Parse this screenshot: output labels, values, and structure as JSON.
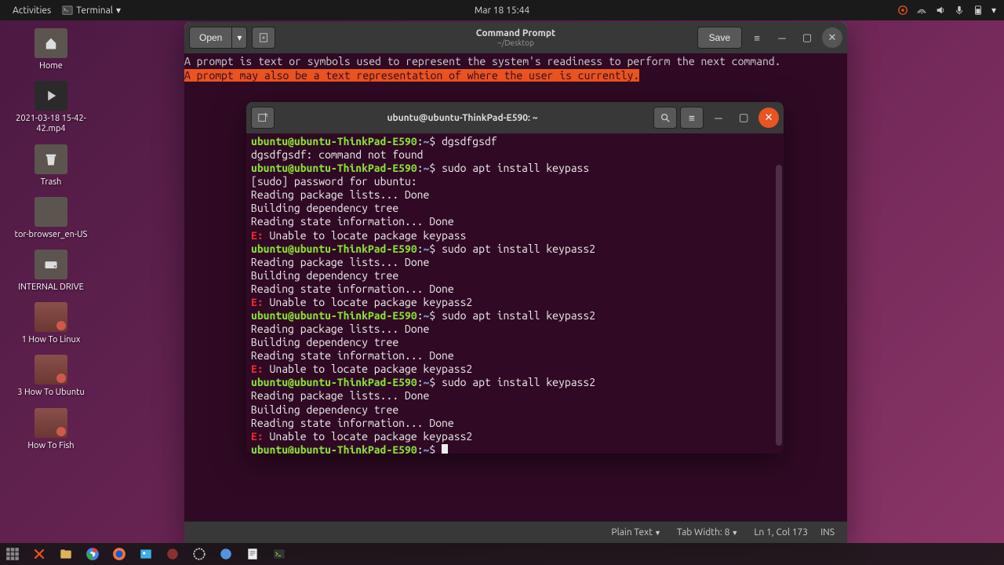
{
  "top_panel": {
    "activities": "Activities",
    "app_menu": "Terminal",
    "clock": "Mar 18  15:44"
  },
  "desktop_icons": [
    {
      "label": "Home",
      "kind": "folder"
    },
    {
      "label": "2021-03-18 15-42-42.mp4",
      "kind": "video"
    },
    {
      "label": "Trash",
      "kind": "folder"
    },
    {
      "label": "tor-browser_en-US",
      "kind": "folder"
    },
    {
      "label": "INTERNAL DRIVE",
      "kind": "folder"
    },
    {
      "label": "1 How To Linux",
      "kind": "folder-red"
    },
    {
      "label": "3 How To Ubuntu",
      "kind": "folder-red"
    },
    {
      "label": "How To Fish",
      "kind": "folder-red"
    }
  ],
  "gedit": {
    "open": "Open",
    "save": "Save",
    "title": "Command Prompt",
    "subtitle": "~/Desktop",
    "line1": "A prompt is text or symbols used to represent the system's readiness to perform the next command.",
    "line2": "A prompt may also be a text representation of where the user is currently.",
    "status": {
      "syntax": "Plain Text",
      "tabwidth": "Tab Width: 8",
      "position": "Ln 1, Col 173",
      "insert": "INS"
    }
  },
  "terminal": {
    "title": "ubuntu@ubuntu-ThinkPad-E590: ~",
    "prompt": {
      "host": "ubuntu@ubuntu-ThinkPad-E590",
      "path": "~",
      "sep": ":",
      "dollar": "$"
    },
    "history": [
      {
        "type": "prompt",
        "cmd": "dgsdfgsdf"
      },
      {
        "type": "out",
        "text": "dgsdfgsdf: command not found"
      },
      {
        "type": "prompt",
        "cmd": "sudo apt install keypass"
      },
      {
        "type": "out",
        "text": "[sudo] password for ubuntu: "
      },
      {
        "type": "out",
        "text": "Reading package lists... Done"
      },
      {
        "type": "out",
        "text": "Building dependency tree       "
      },
      {
        "type": "out",
        "text": "Reading state information... Done"
      },
      {
        "type": "err",
        "text": "Unable to locate package keypass"
      },
      {
        "type": "prompt",
        "cmd": "sudo apt install keypass2"
      },
      {
        "type": "out",
        "text": "Reading package lists... Done"
      },
      {
        "type": "out",
        "text": "Building dependency tree       "
      },
      {
        "type": "out",
        "text": "Reading state information... Done"
      },
      {
        "type": "err",
        "text": "Unable to locate package keypass2"
      },
      {
        "type": "prompt",
        "cmd": "sudo apt install keypass2"
      },
      {
        "type": "out",
        "text": "Reading package lists... Done"
      },
      {
        "type": "out",
        "text": "Building dependency tree       "
      },
      {
        "type": "out",
        "text": "Reading state information... Done"
      },
      {
        "type": "err",
        "text": "Unable to locate package keypass2"
      },
      {
        "type": "prompt",
        "cmd": "sudo apt install keypass2"
      },
      {
        "type": "out",
        "text": "Reading package lists... Done"
      },
      {
        "type": "out",
        "text": "Building dependency tree       "
      },
      {
        "type": "out",
        "text": "Reading state information... Done"
      },
      {
        "type": "err",
        "text": "Unable to locate package keypass2"
      },
      {
        "type": "prompt",
        "cmd": "",
        "cursor": true
      }
    ]
  },
  "dock_items": [
    "show-apps",
    "x-app",
    "files",
    "chrome",
    "firefox",
    "thunderbird",
    "app-red",
    "app-circle",
    "app-blue",
    "gedit",
    "terminal"
  ]
}
